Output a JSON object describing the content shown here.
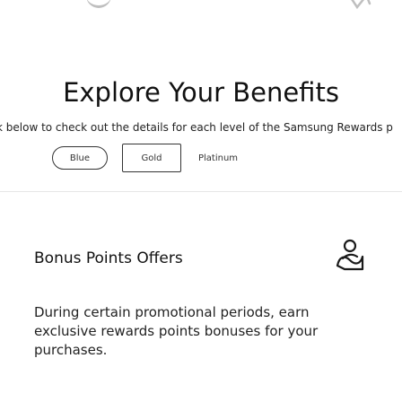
{
  "hero": {
    "headline": "Explore Your Benefits",
    "subline": "k below to check out the details for each level of the Samsung Rewards p"
  },
  "tiers": [
    {
      "label": "Blue",
      "selected": true
    },
    {
      "label": "Gold",
      "selected": false
    },
    {
      "label": "Platinum",
      "selected": false
    }
  ],
  "offer": {
    "title": "Bonus Points Offers",
    "icon": "bonus-offer-icon",
    "body": "During certain promotional periods, earn exclusive rewards points bonuses for your purchases."
  }
}
